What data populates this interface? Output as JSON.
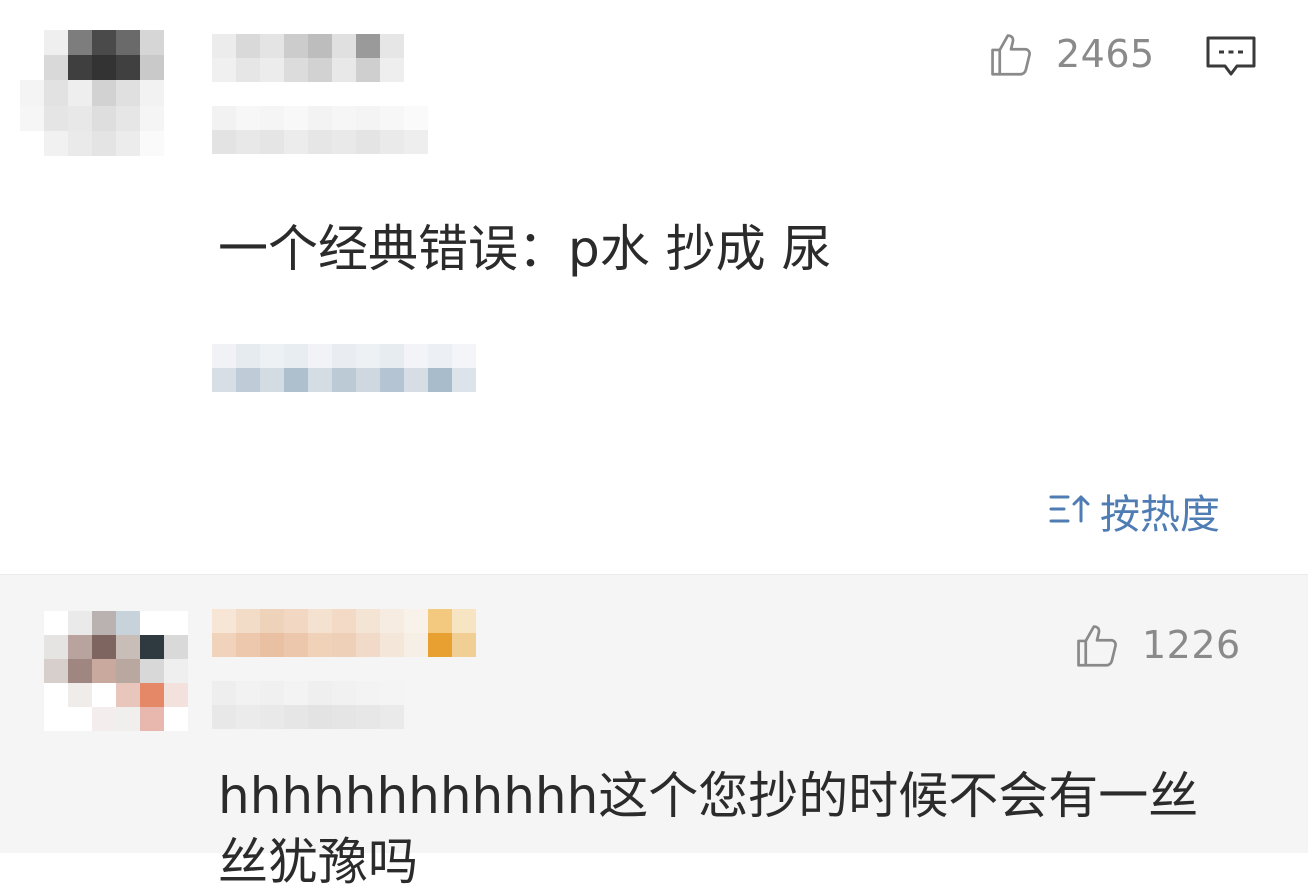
{
  "comments": [
    {
      "likes": "2465",
      "text": "一个经典错误：p水 抄成 尿",
      "avatar_colors": [
        "#ffffff",
        "#efefef",
        "#7d7d7d",
        "#4a4a4a",
        "#6a6a6a",
        "#d6d6d6",
        "#ffffff",
        "#ffffff",
        "#d9d9d9",
        "#3f3f3f",
        "#333333",
        "#404040",
        "#c9c9c9",
        "#ffffff",
        "#f4f4f4",
        "#e2e2e2",
        "#eeeeee",
        "#d2d2d2",
        "#e0e0e0",
        "#f2f2f2",
        "#ffffff",
        "#f6f6f6",
        "#e5e5e5",
        "#e8e8e8",
        "#dedede",
        "#e6e6e6",
        "#f5f5f5",
        "#ffffff",
        "#ffffff",
        "#f1f1f1",
        "#eaeaea",
        "#e4e4e4",
        "#ececec",
        "#fafafa",
        "#ffffff"
      ],
      "name_colors": [
        "#ececec",
        "#d9d9d9",
        "#e4e4e4",
        "#cccccc",
        "#bdbdbd",
        "#e0e0e0",
        "#9a9a9a",
        "#e6e6e6",
        "#f0f0f0",
        "#e6e6e6",
        "#ececec",
        "#dcdcdc",
        "#d2d2d2",
        "#e8e8e8",
        "#cfcfcf",
        "#eeeeee"
      ],
      "meta_colors": [
        "#f2f2f2",
        "#f7f7f7",
        "#f5f5f5",
        "#f8f8f8",
        "#f3f3f3",
        "#f6f6f6",
        "#f4f4f4",
        "#f7f7f7",
        "#fafafa",
        "#e3e3e3",
        "#e8e8e8",
        "#e5e5e5",
        "#ececec",
        "#e6e6e6",
        "#e9e9e9",
        "#e4e4e4",
        "#eaeaea",
        "#eeeeee"
      ],
      "tag_colors": [
        "#f0f2f5",
        "#e6ebf0",
        "#eef1f4",
        "#e8edf2",
        "#f1f3f6",
        "#e9edf1",
        "#eef1f4",
        "#e7ecf1",
        "#f2f4f7",
        "#eceff3",
        "#f3f5f8",
        "#d7dee6",
        "#bfccd8",
        "#d3dbe3",
        "#aebfce",
        "#d4dce4",
        "#bccad6",
        "#cfd8e1",
        "#b4c4d2",
        "#d6dde5",
        "#a9bccc",
        "#dde3ea"
      ]
    },
    {
      "likes": "1226",
      "text": "hhhhhhhhhhhh这个您抄的时候不会有一丝丝犹豫吗",
      "avatar_colors": [
        "#ffffff",
        "#eaeaea",
        "#b9b2b0",
        "#c8d2da",
        "#ffffff",
        "#ffffff",
        "#e6e4e3",
        "#b8a39e",
        "#7e6560",
        "#c9bdb8",
        "#2f3a40",
        "#d9d9d9",
        "#d7cfcb",
        "#a08680",
        "#c9a89e",
        "#b9a89f",
        "#d8d8d8",
        "#efefef",
        "#ffffff",
        "#f0ece9",
        "#ffffff",
        "#e9c6bb",
        "#e48868",
        "#f2e1dc",
        "#ffffff",
        "#ffffff",
        "#f3eded",
        "#f1efee",
        "#e8b7ae",
        "#ffffff"
      ],
      "name_colors": [
        "#f7e6d6",
        "#f3dcc7",
        "#efd2ba",
        "#f2d8c2",
        "#f5e1cf",
        "#f3dac6",
        "#f4e4d4",
        "#f6ece2",
        "#f8f2ea",
        "#f3c97f",
        "#f7e4c2",
        "#f1d3bc",
        "#edc8ad",
        "#e9c0a2",
        "#ecc7ab",
        "#f0d2b9",
        "#eed0b8",
        "#f1dbc8",
        "#f4e7da",
        "#f6efe6",
        "#e8a030",
        "#f1cf94"
      ],
      "meta_colors": [
        "#eeeeee",
        "#f2f2f2",
        "#f0f0f0",
        "#f3f3f3",
        "#efefef",
        "#f1f1f1",
        "#f3f3f3",
        "#f4f4f4",
        "#e8e8e8",
        "#ebebeb",
        "#e9e9e9",
        "#e6e6e6",
        "#e3e3e3",
        "#e5e5e5",
        "#e7e7e7",
        "#eaeaea"
      ]
    }
  ],
  "sort": {
    "label": "按热度",
    "icon": "sort-icon"
  },
  "colors": {
    "text": "#2b2b2b",
    "muted": "#8a8a8a",
    "link": "#4f7db3",
    "alt_background": "#f5f5f5"
  }
}
